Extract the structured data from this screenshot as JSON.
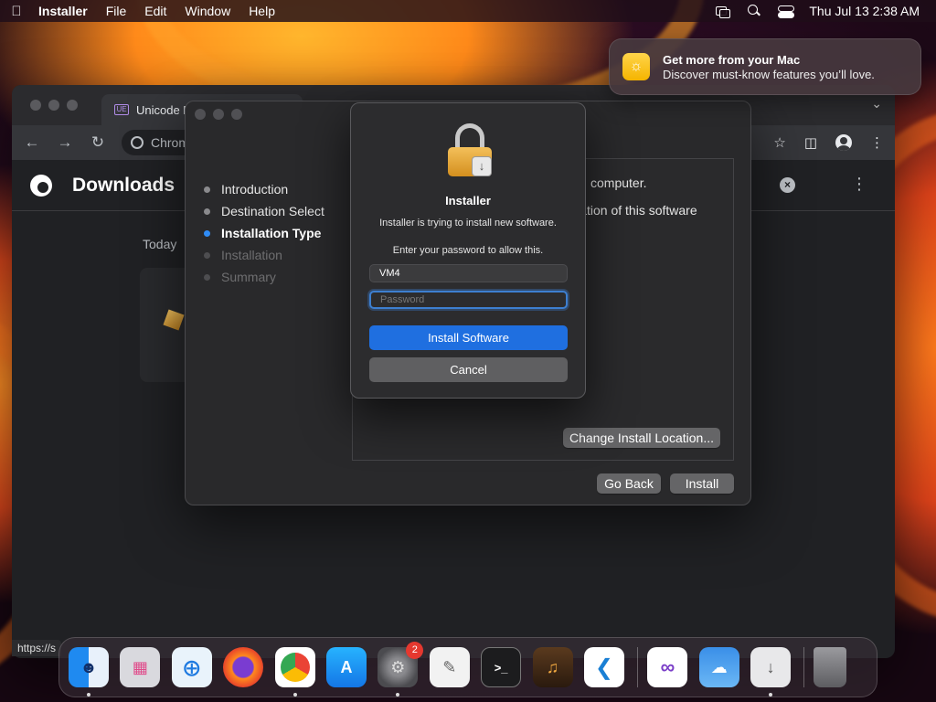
{
  "menubar": {
    "app_name": "Installer",
    "menus": [
      "File",
      "Edit",
      "Window",
      "Help"
    ],
    "clock": "Thu Jul 13  2:38 AM"
  },
  "notification": {
    "title": "Get more from your Mac",
    "body": "Discover must-know features you’ll love.",
    "icon": "lightbulb-icon"
  },
  "chrome": {
    "tab_title": "Unicode B",
    "omnibox_text": "Chrom",
    "page_title": "Downloads",
    "section_today": "Today",
    "status_url": "https://s"
  },
  "installer": {
    "steps": [
      {
        "label": "Introduction",
        "state": "done"
      },
      {
        "label": "Destination Select",
        "state": "done"
      },
      {
        "label": "Installation Type",
        "state": "active"
      },
      {
        "label": "Installation",
        "state": "pending"
      },
      {
        "label": "Summary",
        "state": "pending"
      }
    ],
    "content_line1": "computer.",
    "content_line2": "llation of this software",
    "change_location_label": "Change Install Location...",
    "go_back_label": "Go Back",
    "install_label": "Install"
  },
  "auth_dialog": {
    "title": "Installer",
    "subtitle": "Installer is trying to install new software.",
    "prompt": "Enter your password to allow this.",
    "username_value": "VM4",
    "password_placeholder": "Password",
    "primary_button": "Install Software",
    "secondary_button": "Cancel"
  },
  "dock": {
    "apps": [
      {
        "name": "finder",
        "running": true,
        "badge": ""
      },
      {
        "name": "launchpad",
        "running": false,
        "badge": ""
      },
      {
        "name": "safari",
        "running": false,
        "badge": ""
      },
      {
        "name": "firefox",
        "running": false,
        "badge": ""
      },
      {
        "name": "chrome",
        "running": true,
        "badge": ""
      },
      {
        "name": "app-store",
        "running": false,
        "badge": ""
      },
      {
        "name": "system-settings",
        "running": true,
        "badge": "2"
      },
      {
        "name": "textedit",
        "running": false,
        "badge": ""
      },
      {
        "name": "terminal",
        "running": false,
        "badge": ""
      },
      {
        "name": "garageband",
        "running": false,
        "badge": ""
      },
      {
        "name": "vscode",
        "running": false,
        "badge": ""
      },
      {
        "name": "visual-studio",
        "running": false,
        "badge": ""
      },
      {
        "name": "weather",
        "running": false,
        "badge": ""
      },
      {
        "name": "installer",
        "running": true,
        "badge": ""
      },
      {
        "name": "trash",
        "running": false,
        "badge": ""
      }
    ]
  },
  "colors": {
    "accent": "#1f6fe0",
    "active_step_dot": "#2f8cf6",
    "badge_red": "#e5382f"
  }
}
